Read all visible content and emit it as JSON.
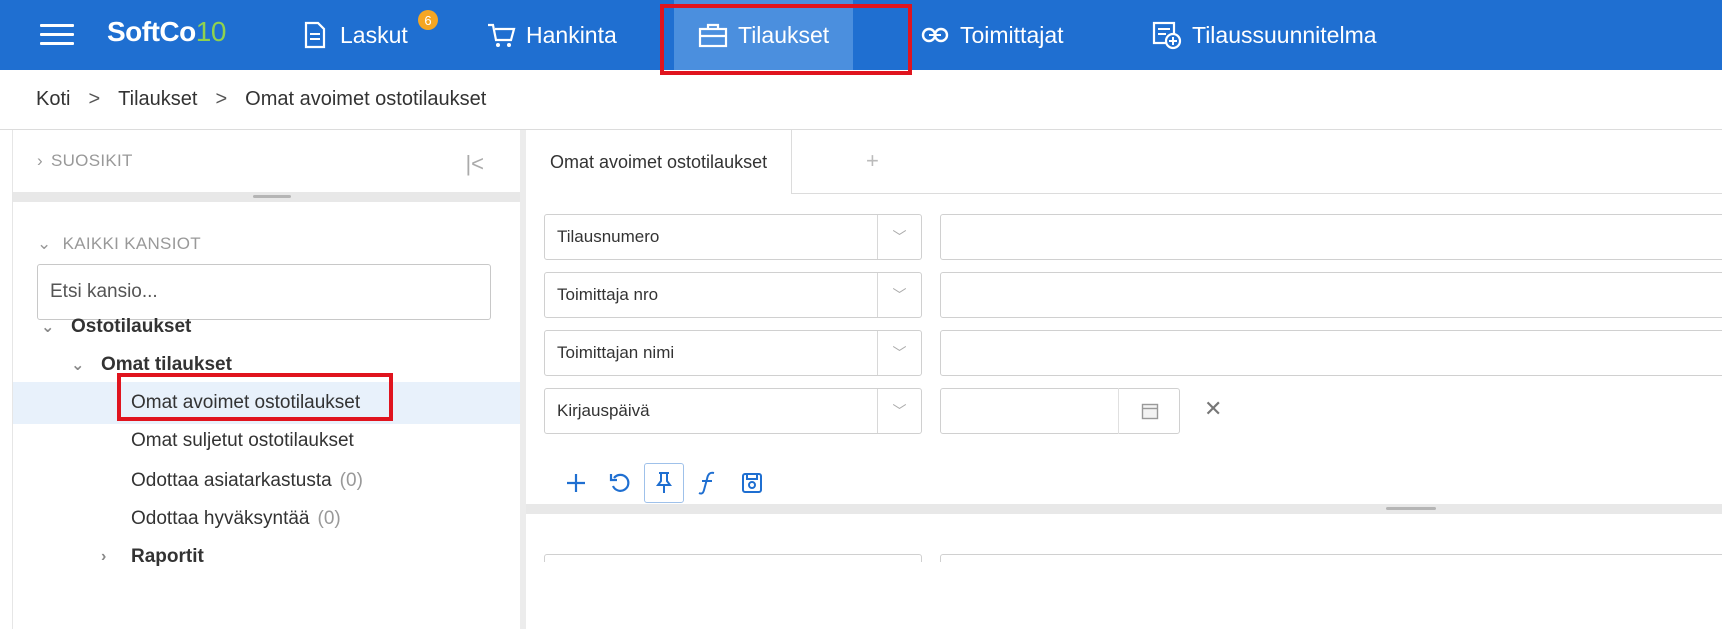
{
  "nav": {
    "logo_main": "SoftCo",
    "logo_suffix": "10",
    "items": [
      {
        "label": "Laskut",
        "icon": "document-icon",
        "badge": "6"
      },
      {
        "label": "Hankinta",
        "icon": "cart-icon"
      },
      {
        "label": "Tilaukset",
        "icon": "briefcase-icon",
        "active": true
      },
      {
        "label": "Toimittajat",
        "icon": "handshake-icon"
      },
      {
        "label": "Tilaussuunnitelma",
        "icon": "plan-add-icon"
      }
    ],
    "accent_color": "#1f6fd1",
    "active_color": "#4b8fde",
    "highlight_color": "#e0141e"
  },
  "breadcrumb": {
    "items": [
      "Koti",
      "Tilaukset",
      "Omat avoimet ostotilaukset"
    ],
    "separator": ">"
  },
  "sidebar": {
    "favorites_label": "SUOSIKIT",
    "all_folders_label": "KAIKKI KANSIOT",
    "search_placeholder": "Etsi kansio...",
    "tree": [
      {
        "label": "Ostotilaukset",
        "level": 0,
        "expanded": true,
        "bold": true
      },
      {
        "label": "Omat tilaukset",
        "level": 1,
        "expanded": true,
        "bold": true
      },
      {
        "label": "Omat avoimet ostotilaukset",
        "level": 2,
        "selected": true
      },
      {
        "label": "Omat suljetut ostotilaukset",
        "level": 2
      },
      {
        "label": "Odottaa asiatarkastusta",
        "level": 2,
        "count": "(0)"
      },
      {
        "label": "Odottaa hyväksyntää",
        "level": 2,
        "count": "(0)"
      },
      {
        "label": "Raportit",
        "level": 1,
        "expanded": false,
        "bold": true
      }
    ]
  },
  "main": {
    "tab_label": "Omat avoimet ostotilaukset",
    "tab_add": "+",
    "filters": [
      {
        "field": "Tilausnumero",
        "value": ""
      },
      {
        "field": "Toimittaja nro",
        "value": ""
      },
      {
        "field": "Toimittajan nimi",
        "value": ""
      },
      {
        "field": "Kirjauspäivä",
        "value": "",
        "type": "date"
      }
    ],
    "toolbar": [
      "add-icon",
      "reset-icon",
      "pin-icon",
      "function-icon",
      "save-icon"
    ]
  }
}
